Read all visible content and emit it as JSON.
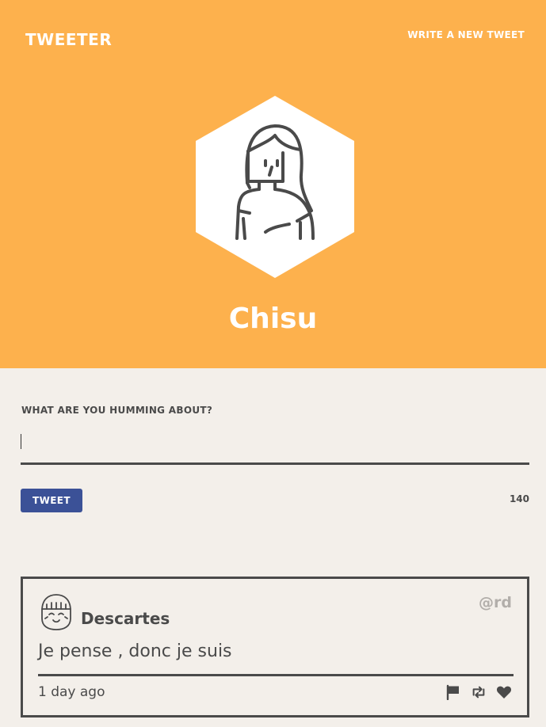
{
  "nav": {
    "brand": "TWEETER",
    "write_link": "WRITE A NEW TWEET"
  },
  "profile": {
    "name": "Chisu"
  },
  "compose": {
    "label": "WHAT ARE YOU HUMMING ABOUT?",
    "value": "",
    "placeholder": "",
    "button_label": "TWEET",
    "counter": "140"
  },
  "tweets": [
    {
      "author": "Descartes",
      "handle": "@rd",
      "text": "Je pense , donc je suis",
      "time": "1 day ago",
      "actions": [
        "flag-icon",
        "retweet-icon",
        "heart-icon"
      ]
    }
  ],
  "colors": {
    "header_bg": "#fdb14d",
    "page_bg": "#f3efea",
    "button_bg": "#3b5197",
    "text": "#4a4a4a",
    "handle": "#b2aeaa"
  }
}
